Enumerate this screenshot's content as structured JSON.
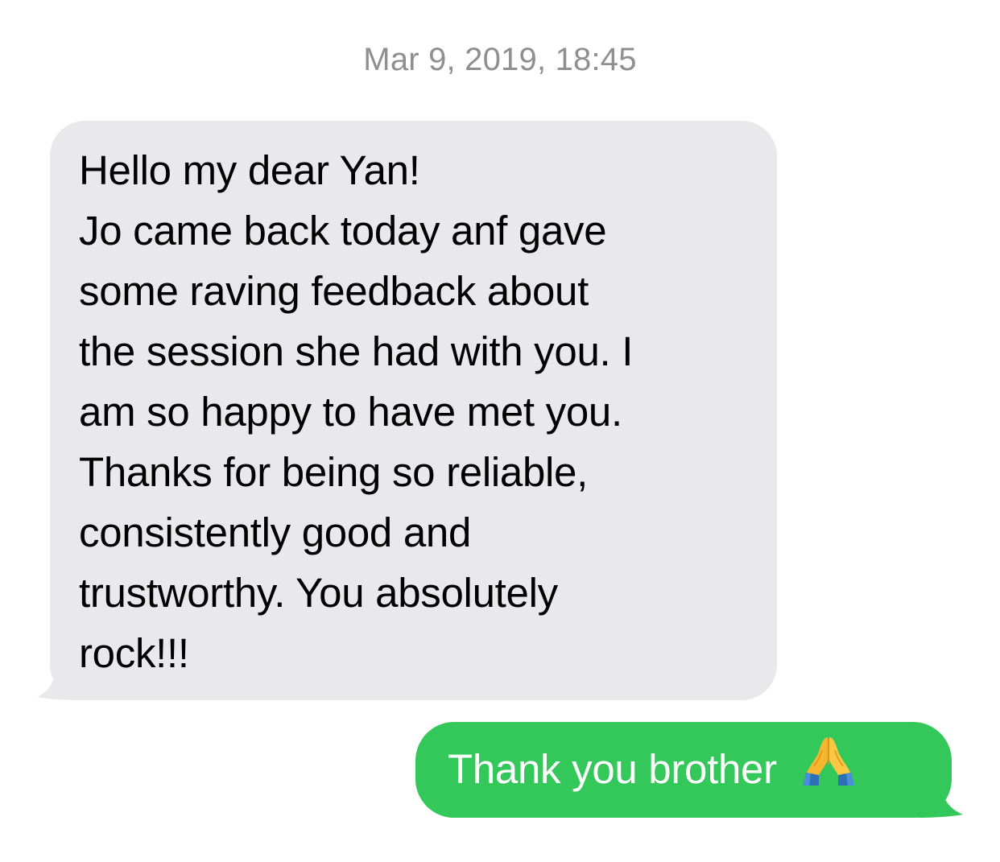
{
  "conversation": {
    "timestamp": "Mar 9, 2019, 18:45",
    "incoming_message": {
      "lines": [
        "Hello my dear Yan!",
        "Jo came back today anf gave",
        "some raving feedback about",
        "the session she had with you. I",
        "am so happy to have met you.",
        "Thanks for being so reliable,",
        "consistently good and",
        "trustworthy. You absolutely",
        "rock!!!"
      ]
    },
    "outgoing_message": {
      "text": "Thank you brother",
      "emoji": "folded-hands-emoji"
    }
  },
  "colors": {
    "incoming_bubble": "#e9e9eb",
    "outgoing_bubble": "#34c759",
    "timestamp_text": "#8e8e93"
  }
}
